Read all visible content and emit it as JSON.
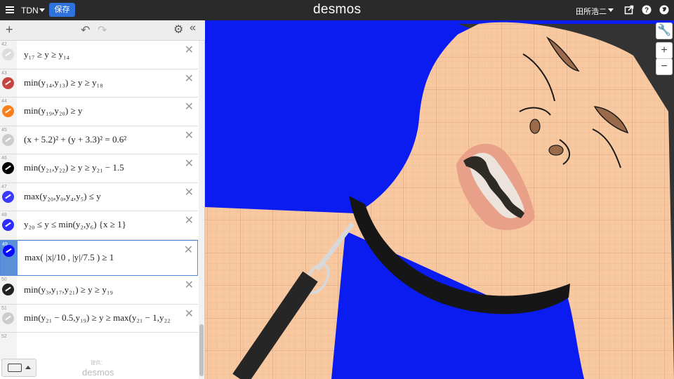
{
  "topbar": {
    "graph_title": "TDN",
    "save_label": "保存",
    "logo": "desmos",
    "user_name": "田所浩二",
    "icons": [
      "share-icon",
      "help-icon",
      "globe-icon"
    ]
  },
  "panel": {
    "toolbar_icons": [
      "add-icon",
      "undo-icon",
      "redo-icon",
      "settings-icon",
      "collapse-icon"
    ],
    "powered_by_label": "提供：",
    "powered_by_brand": "desmos",
    "expressions": [
      {
        "num": "42",
        "latex": "y₁₇ ≥ y ≥ y₁₄",
        "color": "#dddddd"
      },
      {
        "num": "43",
        "latex": "min(y₁₄,y₁₃) ≥ y ≥ y₁₈",
        "color": "#c74440"
      },
      {
        "num": "44",
        "latex": "min(y₁₉,y₂₀) ≥ y",
        "color": "#fa7e19"
      },
      {
        "num": "45",
        "latex": "(x + 5.2)² + (y + 3.3)² = 0.6²",
        "color": "#cccccc"
      },
      {
        "num": "46",
        "latex": "min(y₂₁,y₂₂) ≥ y ≥ y₂₁ − 1.5",
        "color": "#000000"
      },
      {
        "num": "47",
        "latex": "max(y₂₀,y₀,y₄,y₅) ≤ y",
        "color": "#3a3aff"
      },
      {
        "num": "48",
        "latex": "y₂₀ ≤ y ≤ min(y₂,y₆) {x ≥ 1}",
        "color": "#2d2dff"
      },
      {
        "num": "49",
        "latex": "max( |x|/10 , |y|/7.5 ) ≥ 1",
        "color": "#0a0aff"
      },
      {
        "num": "50",
        "latex": "min(y₃,y₁₇,y₂₁) ≥ y ≥ y₁₉",
        "color": "#222222"
      },
      {
        "num": "51",
        "latex": "min(y₂₁ − 0.5,y₁₉) ≥ y ≥ max(y₂₁ − 1,y₂₂",
        "color": "#cccccc"
      },
      {
        "num": "52",
        "latex": "",
        "color": ""
      }
    ]
  },
  "graph": {
    "background_color": "#0a1cf0",
    "skin_color": "#f8c8a0",
    "hair_color": "#333333",
    "buttons": [
      "wrench-icon",
      "zoom-in-icon",
      "zoom-out-icon"
    ]
  }
}
